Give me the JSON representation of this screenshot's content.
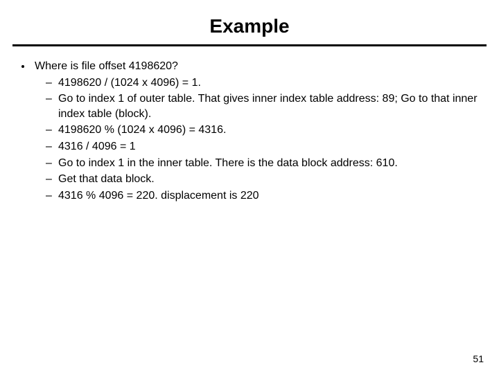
{
  "title": "Example",
  "lead": "Where is file offset 4198620?",
  "items": [
    "4198620 / (1024 x 4096)  = 1.",
    "Go to index 1 of outer table. That  gives inner index table address: 89; Go to that inner index table (block).",
    " 4198620 % (1024 x 4096)  = 4316.",
    "4316 / 4096 = 1",
    "Go to index 1 in the inner table. There is the data block address: 610.",
    "Get that  data block.",
    "4316 % 4096 = 220. displacement is 220"
  ],
  "page_number": "51"
}
